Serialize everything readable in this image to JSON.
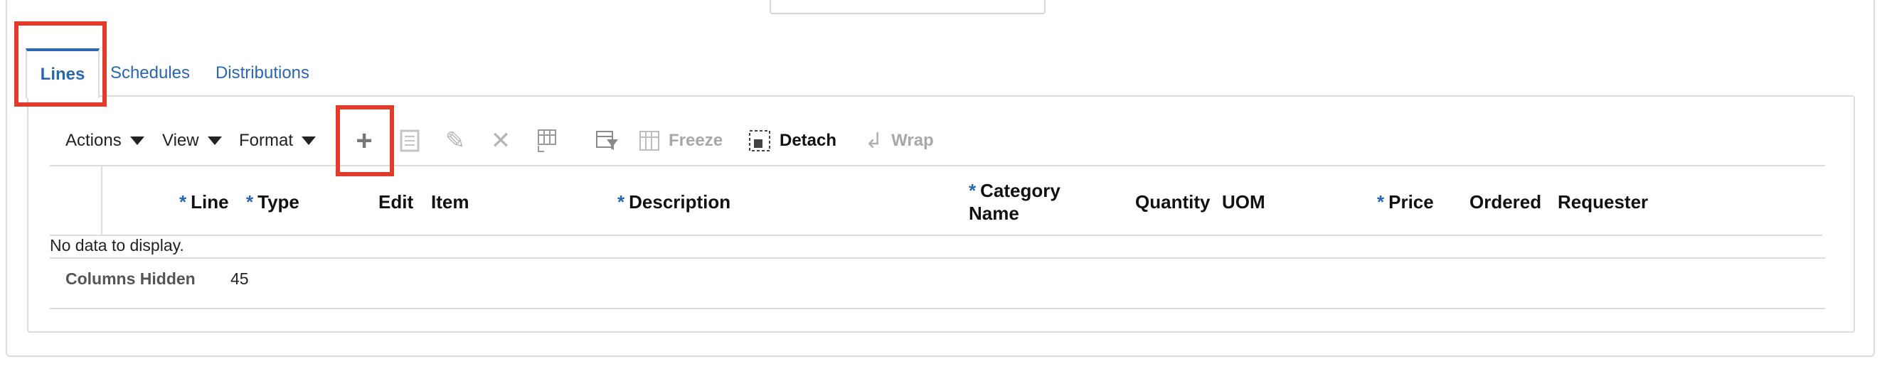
{
  "tabs": [
    {
      "label": "Lines",
      "active": true
    },
    {
      "label": "Schedules",
      "active": false
    },
    {
      "label": "Distributions",
      "active": false
    }
  ],
  "toolbar": {
    "actions_label": "Actions",
    "view_label": "View",
    "format_label": "Format",
    "freeze_label": "Freeze",
    "detach_label": "Detach",
    "wrap_label": "Wrap",
    "icons": [
      "add-icon",
      "export-icon",
      "edit-icon",
      "delete-icon",
      "manage-columns-icon",
      "query-by-example-icon",
      "freeze-icon",
      "detach-icon",
      "wrap-icon"
    ]
  },
  "table": {
    "columns": [
      {
        "label": "Line",
        "required": true
      },
      {
        "label": "Type",
        "required": true
      },
      {
        "label": "Edit",
        "required": false
      },
      {
        "label": "Item",
        "required": false
      },
      {
        "label": "Description",
        "required": true
      },
      {
        "label": "Category Name",
        "required": true
      },
      {
        "label": "Quantity",
        "required": false
      },
      {
        "label": "UOM",
        "required": false
      },
      {
        "label": "Price",
        "required": true
      },
      {
        "label": "Ordered",
        "required": false
      },
      {
        "label": "Requester",
        "required": false
      }
    ],
    "required_marker": "*",
    "empty_message": "No data to display.",
    "columns_hidden_label": "Columns Hidden",
    "columns_hidden_count": "45"
  },
  "colors": {
    "accent": "#2b66b0",
    "highlight": "#e23b2b",
    "border": "#dcdcdc"
  }
}
